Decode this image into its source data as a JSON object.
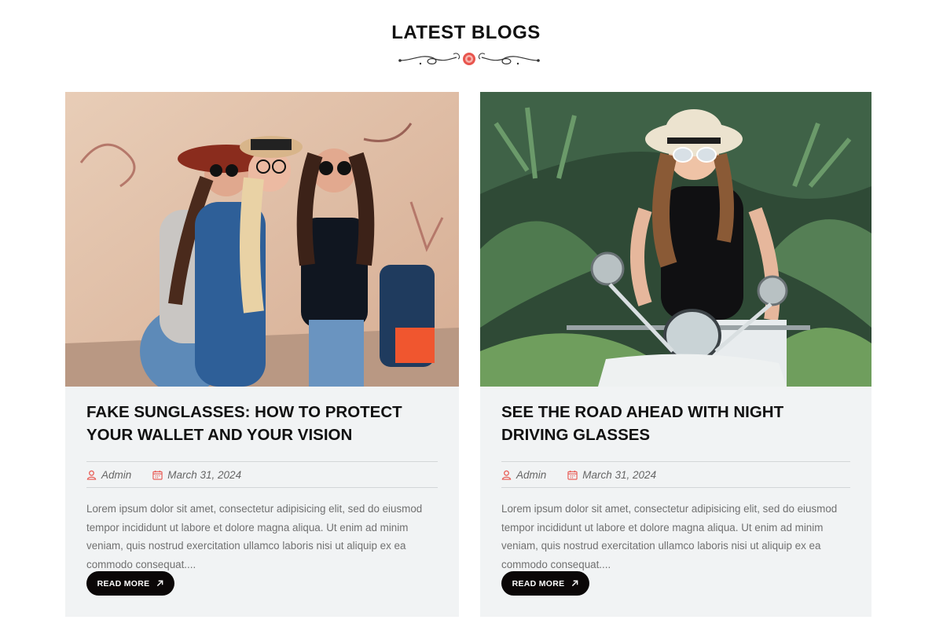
{
  "section": {
    "title": "LATEST BLOGS"
  },
  "posts": [
    {
      "title": "FAKE SUNGLASSES: HOW TO PROTECT YOUR WALLET AND YOUR VISION",
      "author": "Admin",
      "date": "March 31, 2024",
      "excerpt": "Lorem ipsum dolor sit amet, consectetur adipisicing elit, sed do eiusmod tempor incididunt ut labore et dolore magna aliqua. Ut enim ad minim veniam, quis nostrud exercitation ullamco laboris nisi ut aliquip ex ea commodo consequat....",
      "button": "READ MORE",
      "image_icon": "three-women-sunglasses-photo"
    },
    {
      "title": "SEE THE ROAD AHEAD WITH NIGHT DRIVING GLASSES",
      "author": "Admin",
      "date": "March 31, 2024",
      "excerpt": "Lorem ipsum dolor sit amet, consectetur adipisicing elit, sed do eiusmod tempor incididunt ut labore et dolore magna aliqua. Ut enim ad minim veniam, quis nostrud exercitation ullamco laboris nisi ut aliquip ex ea commodo consequat....",
      "button": "READ MORE",
      "image_icon": "woman-on-scooter-photo"
    }
  ],
  "colors": {
    "accent": "#e8554e",
    "card_bg": "#f1f3f4",
    "button_bg": "#0b0707"
  }
}
